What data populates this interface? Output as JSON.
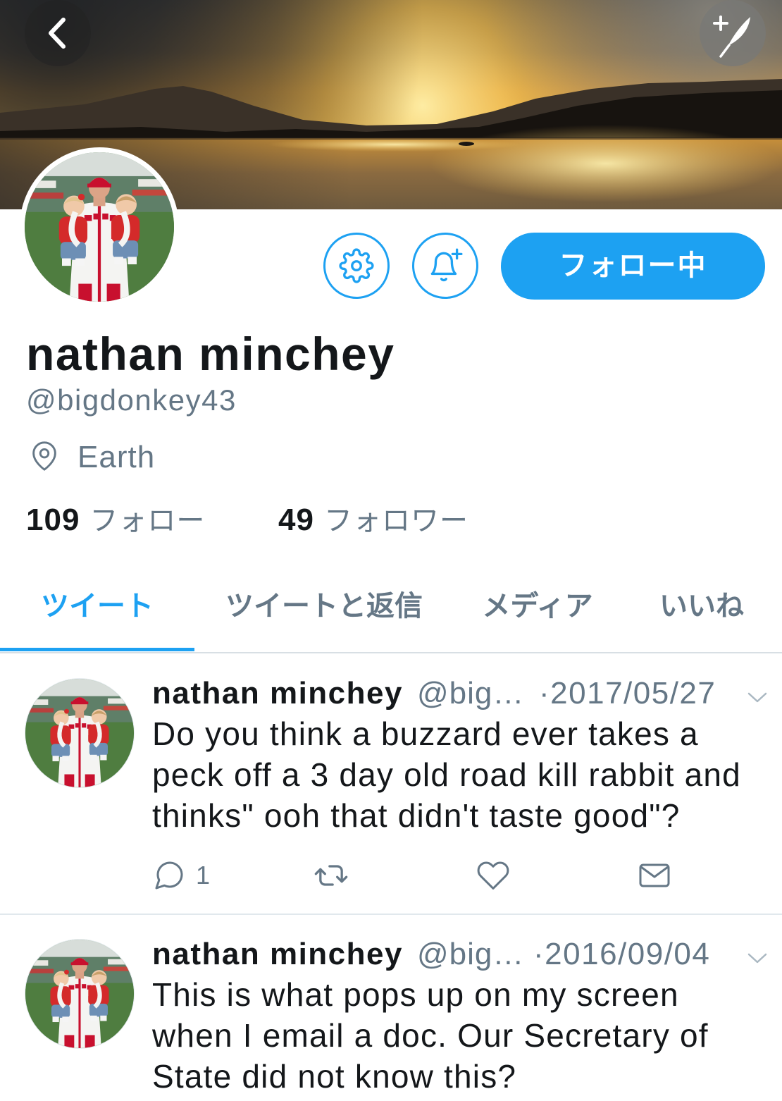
{
  "header": {
    "back_icon": "chevron-left-icon",
    "compose_icon": "compose-tweet-icon"
  },
  "profile": {
    "settings_icon": "gear-icon",
    "notifications_icon": "bell-plus-icon",
    "follow_button_label": "フォロー中",
    "name": "nathan minchey",
    "handle": "@bigdonkey43",
    "location_icon": "location-pin-icon",
    "location": "Earth",
    "following_count": "109",
    "following_label": "フォロー",
    "followers_count": "49",
    "followers_label": "フォロワー"
  },
  "tabs": [
    {
      "label": "ツイート",
      "active": true
    },
    {
      "label": "ツイートと返信",
      "active": false
    },
    {
      "label": "メディア",
      "active": false
    },
    {
      "label": "いいね",
      "active": false
    }
  ],
  "tweets": [
    {
      "name": "nathan minchey",
      "handle": "@big…",
      "date": "·2017/05/27",
      "text_lines": [
        "Do you think a buzzard ever takes a",
        "peck off a 3 day old road kill rabbit and",
        "thinks\" ooh that didn't taste good\"?"
      ],
      "reply_count": "1",
      "action_icons": [
        "reply-icon",
        "retweet-icon",
        "like-icon",
        "direct-message-icon"
      ]
    },
    {
      "name": "nathan minchey",
      "handle": "@big…",
      "date": "·2016/09/04",
      "text_lines": [
        "This is what pops up on my screen",
        "when I email a doc. Our Secretary of",
        "State did not know this?"
      ]
    }
  ],
  "colors": {
    "accent": "#1da1f2",
    "text_primary": "#14171a",
    "text_secondary": "#657786",
    "divider": "#e1e8ed",
    "background": "#ffffff"
  }
}
